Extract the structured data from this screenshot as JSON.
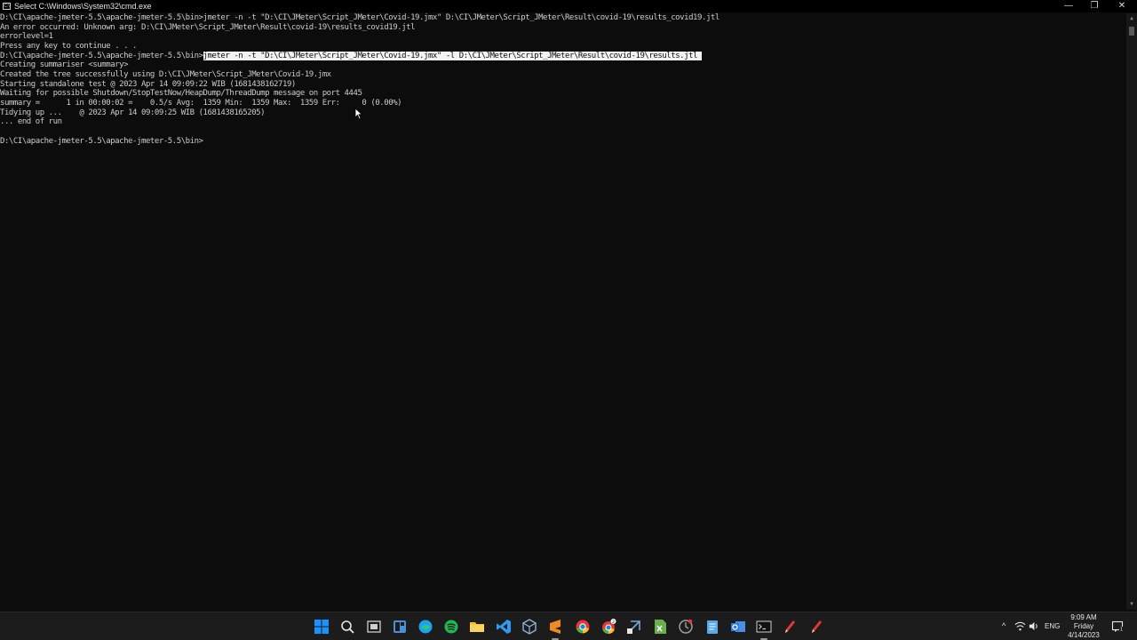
{
  "window": {
    "title": "Select C:\\Windows\\System32\\cmd.exe",
    "icon": "cmd-icon",
    "controls": {
      "minimize": "—",
      "maximize": "❐",
      "close": "✕"
    }
  },
  "terminal": {
    "lines": [
      {
        "text": "D:\\CI\\apache-jmeter-5.5\\apache-jmeter-5.5\\bin>jmeter -n -t \"D:\\CI\\JMeter\\Script_JMeter\\Covid-19.jmx\" D:\\CI\\JMeter\\Script_JMeter\\Result\\covid-19\\results_covid19.jtl"
      },
      {
        "text": "An error occurred: Unknown arg: D:\\CI\\JMeter\\Script_JMeter\\Result\\covid-19\\results_covid19.jtl"
      },
      {
        "text": "errorlevel=1"
      },
      {
        "text": "Press any key to continue . . ."
      },
      {
        "prefix": "D:\\CI\\apache-jmeter-5.5\\apache-jmeter-5.5\\bin>",
        "selected": "jmeter -n -t \"D:\\CI\\JMeter\\Script_JMeter\\Covid-19.jmx\" -l D:\\CI\\JMeter\\Script_JMeter\\Result\\covid-19\\results.jtl "
      },
      {
        "text": "Creating summariser <summary>"
      },
      {
        "text": "Created the tree successfully using D:\\CI\\JMeter\\Script_JMeter\\Covid-19.jmx"
      },
      {
        "text": "Starting standalone test @ 2023 Apr 14 09:09:22 WIB (1681438162719)"
      },
      {
        "text": "Waiting for possible Shutdown/StopTestNow/HeapDump/ThreadDump message on port 4445"
      },
      {
        "text": "summary =      1 in 00:00:02 =    0.5/s Avg:  1359 Min:  1359 Max:  1359 Err:     0 (0.00%)"
      },
      {
        "text": "Tidying up ...    @ 2023 Apr 14 09:09:25 WIB (1681438165205)"
      },
      {
        "text": "... end of run"
      },
      {
        "text": ""
      },
      {
        "text": "D:\\CI\\apache-jmeter-5.5\\apache-jmeter-5.5\\bin>"
      }
    ]
  },
  "taskbar": {
    "icons": [
      {
        "name": "windows-start-icon",
        "color": "#1e90ff"
      },
      {
        "name": "search-icon",
        "color": "#e6e6e6"
      },
      {
        "name": "task-view-icon",
        "color": "#cfcfcf"
      },
      {
        "name": "widgets-icon",
        "color": "#4a90d9"
      },
      {
        "name": "edge-browser-icon",
        "color": "#1da1f2"
      },
      {
        "name": "spotify-icon",
        "color": "#1db954"
      },
      {
        "name": "file-explorer-icon",
        "color": "#f2c230"
      },
      {
        "name": "vscode-icon",
        "color": "#2e9af0"
      },
      {
        "name": "virtualbox-icon",
        "color": "#8fb4d8"
      },
      {
        "name": "sublime-text-icon",
        "color": "#f08a24"
      },
      {
        "name": "chrome-icon",
        "color": "#4caf50"
      },
      {
        "name": "chrome-notification-icon",
        "color": "#4caf50"
      },
      {
        "name": "network-tool-icon",
        "color": "#6fa8dc"
      },
      {
        "name": "excel-file-icon",
        "color": "#6ab04c"
      },
      {
        "name": "vpn-shield-icon",
        "color": "#9e9e9e"
      },
      {
        "name": "notepad-icon",
        "color": "#5aa9e6"
      },
      {
        "name": "outlook-icon",
        "color": "#2f7de1"
      },
      {
        "name": "command-prompt-icon",
        "color": "#d0d0d0"
      },
      {
        "name": "pen-tool-icon",
        "color": "#e53935"
      },
      {
        "name": "pen-tool-2-icon",
        "color": "#e53935"
      }
    ],
    "tray": {
      "chevron": "^",
      "language": "ENG",
      "time": "9:09 AM",
      "day": "Friday",
      "date": "4/14/2023"
    }
  }
}
